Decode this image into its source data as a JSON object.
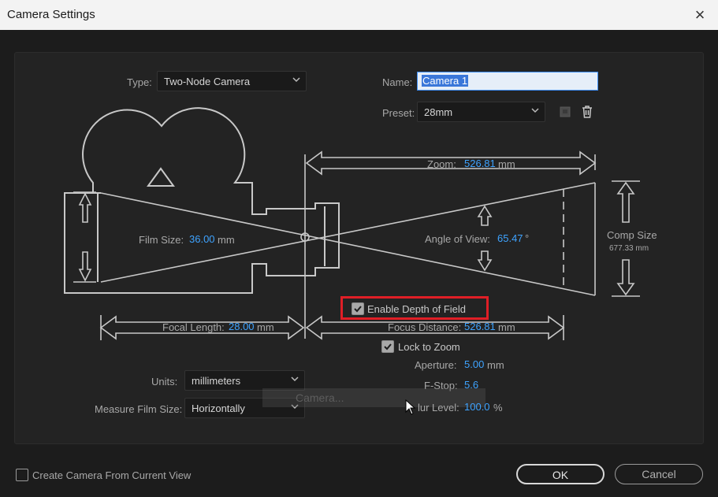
{
  "window": {
    "title": "Camera Settings",
    "close_glyph": "×"
  },
  "type": {
    "label": "Type:",
    "value": "Two-Node Camera"
  },
  "name": {
    "label": "Name:",
    "value": "Camera 1"
  },
  "preset": {
    "label": "Preset:",
    "value": "28mm"
  },
  "zoom": {
    "label": "Zoom:",
    "value": "526.81",
    "unit": "mm"
  },
  "comp_size": {
    "label": "Comp Size",
    "value": "677.33 mm"
  },
  "film_size": {
    "label": "Film Size:",
    "value": "36.00",
    "unit": "mm"
  },
  "angle_of_view": {
    "label": "Angle of View:",
    "value": "65.47",
    "unit": "°"
  },
  "enable_dof": {
    "label": "Enable Depth of Field",
    "checked": true
  },
  "focal_length": {
    "label": "Focal Length:",
    "value": "28.00",
    "unit": "mm"
  },
  "focus_distance": {
    "label": "Focus Distance:",
    "value": "526.81",
    "unit": "mm"
  },
  "lock_to_zoom": {
    "label": "Lock to Zoom",
    "checked": true
  },
  "aperture": {
    "label": "Aperture:",
    "value": "5.00",
    "unit": "mm"
  },
  "fstop": {
    "label": "F-Stop:",
    "value": "5.6"
  },
  "blur_level": {
    "label": "lur Level:",
    "value": "100.0",
    "unit": "%"
  },
  "units": {
    "label": "Units:",
    "value": "millimeters"
  },
  "measure_film_size": {
    "label": "Measure Film Size:",
    "value": "Horizontally"
  },
  "tooltip": {
    "text": "Camera..."
  },
  "create_from_view": {
    "label": "Create Camera From Current View",
    "checked": false
  },
  "buttons": {
    "ok": "OK",
    "cancel": "Cancel"
  },
  "colors": {
    "value_blue": "#3ea3ff",
    "highlight_red": "#e01e26",
    "diagram_line": "#c8c8c8"
  }
}
